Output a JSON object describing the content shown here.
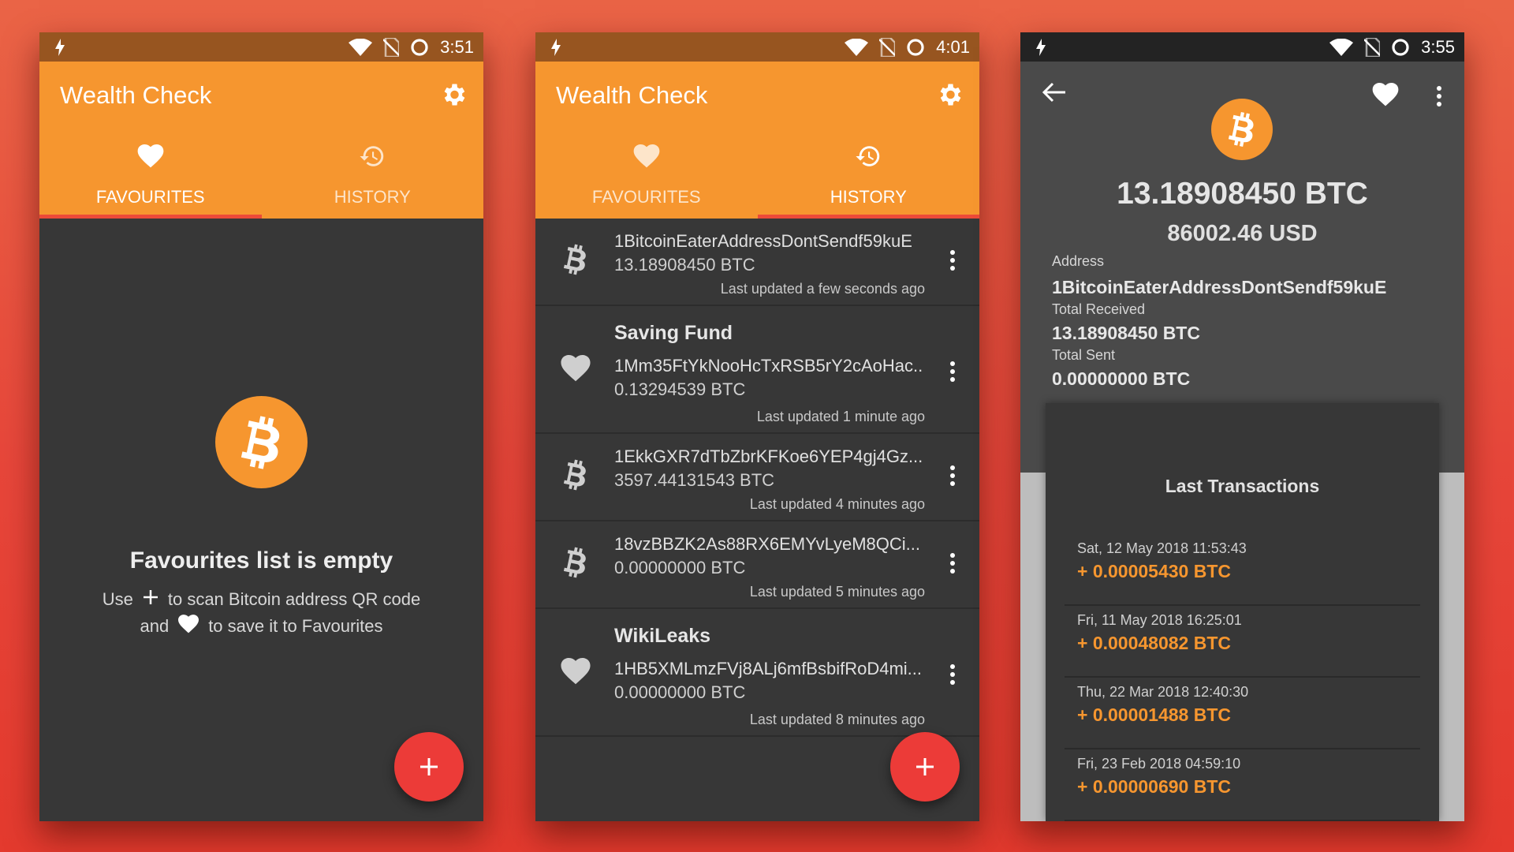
{
  "colors": {
    "accent": "#f6962f",
    "status_orange": "#975520",
    "status_dark": "#232323",
    "panel": "#373737",
    "fab": "#ec3b38",
    "indicator": "#ec4a38"
  },
  "screen1": {
    "status": {
      "time": "3:51"
    },
    "app_title": "Wealth Check",
    "tabs": [
      {
        "label": "FAVOURITES",
        "icon": "heart-icon",
        "active": true
      },
      {
        "label": "HISTORY",
        "icon": "history-icon",
        "active": false
      }
    ],
    "empty": {
      "title": "Favourites list is empty",
      "hint1_pre": "Use",
      "hint1_post": "to scan Bitcoin address QR code",
      "hint2_pre": "and",
      "hint2_post": "to save it to Favourites"
    }
  },
  "screen2": {
    "status": {
      "time": "4:01"
    },
    "app_title": "Wealth Check",
    "tabs": [
      {
        "label": "FAVOURITES",
        "icon": "heart-icon",
        "active": false
      },
      {
        "label": "HISTORY",
        "icon": "history-icon",
        "active": true
      }
    ],
    "items": [
      {
        "icon": "bitcoin-icon",
        "name": "",
        "address": "1BitcoinEaterAddressDontSendf59kuE",
        "amount": "13.18908450 BTC",
        "updated": "Last updated a few seconds ago"
      },
      {
        "icon": "heart-icon",
        "name": "Saving Fund",
        "address": "1Mm35FtYkNooHcTxRSB5rY2cAoHac...",
        "amount": "0.13294539 BTC",
        "updated": "Last updated 1 minute ago"
      },
      {
        "icon": "bitcoin-icon",
        "name": "",
        "address": "1EkkGXR7dTbZbrKFKoe6YEP4gj4Gz...",
        "amount": "3597.44131543 BTC",
        "updated": "Last updated 4 minutes ago"
      },
      {
        "icon": "bitcoin-icon",
        "name": "",
        "address": "18vzBBZK2As88RX6EMYvLyeM8QCi...",
        "amount": "0.00000000 BTC",
        "updated": "Last updated 5 minutes ago"
      },
      {
        "icon": "heart-icon",
        "name": "WikiLeaks",
        "address": "1HB5XMLmzFVj8ALj6mfBsbifRoD4mi...",
        "amount": "0.00000000 BTC",
        "updated": "Last updated 8 minutes ago"
      }
    ]
  },
  "screen3": {
    "status": {
      "time": "3:55"
    },
    "btc": "13.18908450 BTC",
    "usd": "86002.46 USD",
    "address_label": "Address",
    "address": "1BitcoinEaterAddressDontSendf59kuE",
    "received_label": "Total Received",
    "received": "13.18908450 BTC",
    "sent_label": "Total Sent",
    "sent": "0.00000000 BTC",
    "tx_title": "Last Transactions",
    "transactions": [
      {
        "date": "Sat, 12 May 2018 11:53:43",
        "amount": "+ 0.00005430 BTC"
      },
      {
        "date": "Fri, 11 May 2018 16:25:01",
        "amount": "+ 0.00048082 BTC"
      },
      {
        "date": "Thu, 22 Mar 2018 12:40:30",
        "amount": "+ 0.00001488 BTC"
      },
      {
        "date": "Fri, 23 Feb 2018 04:59:10",
        "amount": "+ 0.00000690 BTC"
      }
    ]
  }
}
